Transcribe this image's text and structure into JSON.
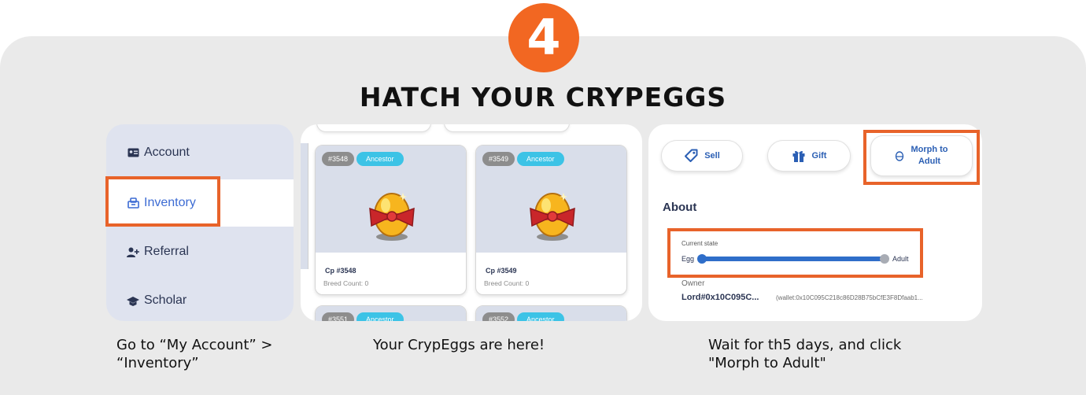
{
  "step": {
    "number": "4",
    "title": "HATCH YOUR CRYPEGGS"
  },
  "colors": {
    "accent": "#f26722",
    "highlight": "#e8632a",
    "link_blue": "#3c6bd3",
    "badge_cyan": "#3cc3e6"
  },
  "account_menu": {
    "items": [
      {
        "label": "Account",
        "icon": "id-card-icon"
      },
      {
        "label": "Inventory",
        "icon": "inventory-box-icon",
        "active": true
      },
      {
        "label": "Referral",
        "icon": "add-user-icon"
      },
      {
        "label": "Scholar",
        "icon": "scholar-hat-icon"
      }
    ]
  },
  "inventory": {
    "eggs": [
      {
        "id_badge": "#3548",
        "tag": "Ancestor",
        "name": "Cp #3548",
        "breed": "Breed Count: 0"
      },
      {
        "id_badge": "#3549",
        "tag": "Ancestor",
        "name": "Cp #3549",
        "breed": "Breed Count: 0"
      },
      {
        "id_badge": "#3551",
        "tag": "Ancestor"
      },
      {
        "id_badge": "#3552",
        "tag": "Ancestor"
      }
    ]
  },
  "egg_detail": {
    "buttons": {
      "sell": "Sell",
      "gift": "Gift",
      "morph_line1": "Morph to",
      "morph_line2": "Adult"
    },
    "about": "About",
    "current_state": {
      "label": "Current state",
      "start": "Egg",
      "end": "Adult",
      "progress": 0
    },
    "owner": {
      "label": "Owner",
      "name": "Lord#0x10C095C...",
      "wallet": "(wallet:0x10C095C218c86D28B75bCfE3F8Dfaab1..."
    }
  },
  "captions": {
    "left_line1": "Go to “My Account” >",
    "left_line2": "“Inventory”",
    "middle": "Your CrypEggs are here!",
    "right_line1": "Wait for th5 days, and click",
    "right_line2": "\"Morph to Adult\""
  }
}
